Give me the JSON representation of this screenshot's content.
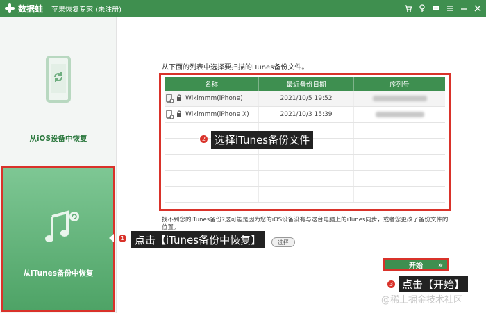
{
  "titlebar": {
    "app_name": "数据蛙",
    "subtitle": "苹果恢复专家 (未注册)",
    "icons": [
      "cart-icon",
      "key-icon",
      "chat-icon",
      "menu-icon",
      "minimize-icon",
      "close-icon"
    ]
  },
  "sidebar": {
    "ios_label": "从iOS设备中恢复",
    "itunes_label": "从iTunes备份中恢复"
  },
  "main": {
    "instruction": "从下面的列表中选择要扫描的iTunes备份文件。",
    "table": {
      "headers": [
        "名称",
        "最近备份日期",
        "序列号"
      ],
      "rows": [
        {
          "name": "Wikimmm(iPhone)",
          "date": "2021/10/5 19:52"
        },
        {
          "name": "Wikimmm(iPhone X)",
          "date": "2021/10/3 15:39"
        }
      ]
    },
    "note": "找不到您的iTunes备份?这可能是因为您的iOS设备没有与这台电脑上的iTunes同步，或者您更改了备份文件的位置。",
    "choose_label": "选择",
    "start_label": "开始",
    "start_chevron": "»"
  },
  "annotations": [
    {
      "num": "1",
      "text": "点击【iTunes备份中恢复】"
    },
    {
      "num": "2",
      "text": "选择iTunes备份文件"
    },
    {
      "num": "3",
      "text": "点击【开始】"
    }
  ],
  "watermark": "@稀土掘金技术社区",
  "colors": {
    "brand_green": "#3f8f4f",
    "highlight_red": "#d9322a",
    "callout_bg": "#222222"
  }
}
